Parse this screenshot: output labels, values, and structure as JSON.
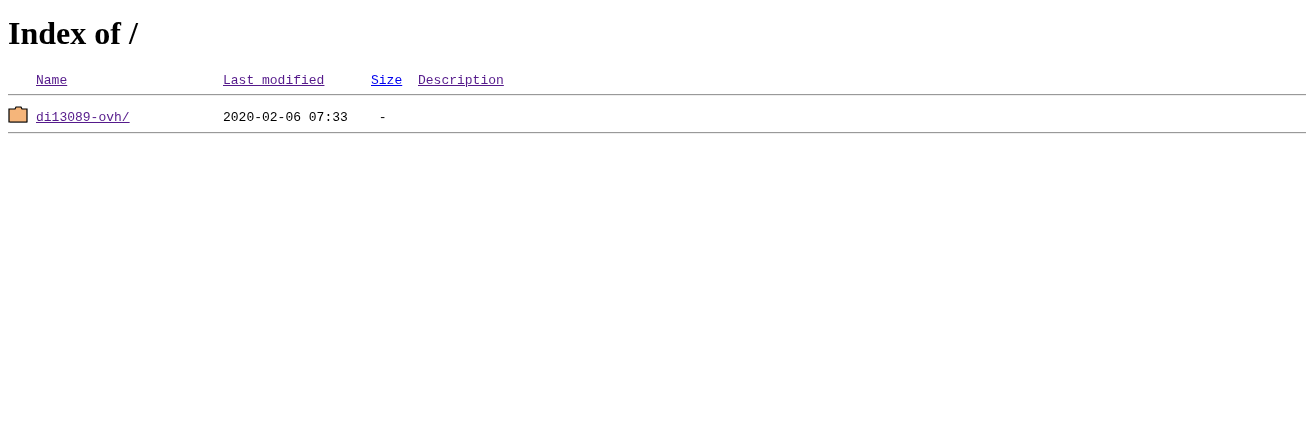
{
  "title": "Index of /",
  "columns": [
    {
      "label": "Name",
      "visited": true
    },
    {
      "label": "Last modified",
      "visited": true
    },
    {
      "label": "Size",
      "visited": false
    },
    {
      "label": "Description",
      "visited": true
    }
  ],
  "rows": [
    {
      "kind": "folder",
      "name": "di13089-ovh/",
      "visited": true,
      "modified": "2020-02-06 07:33",
      "size": "-"
    }
  ]
}
